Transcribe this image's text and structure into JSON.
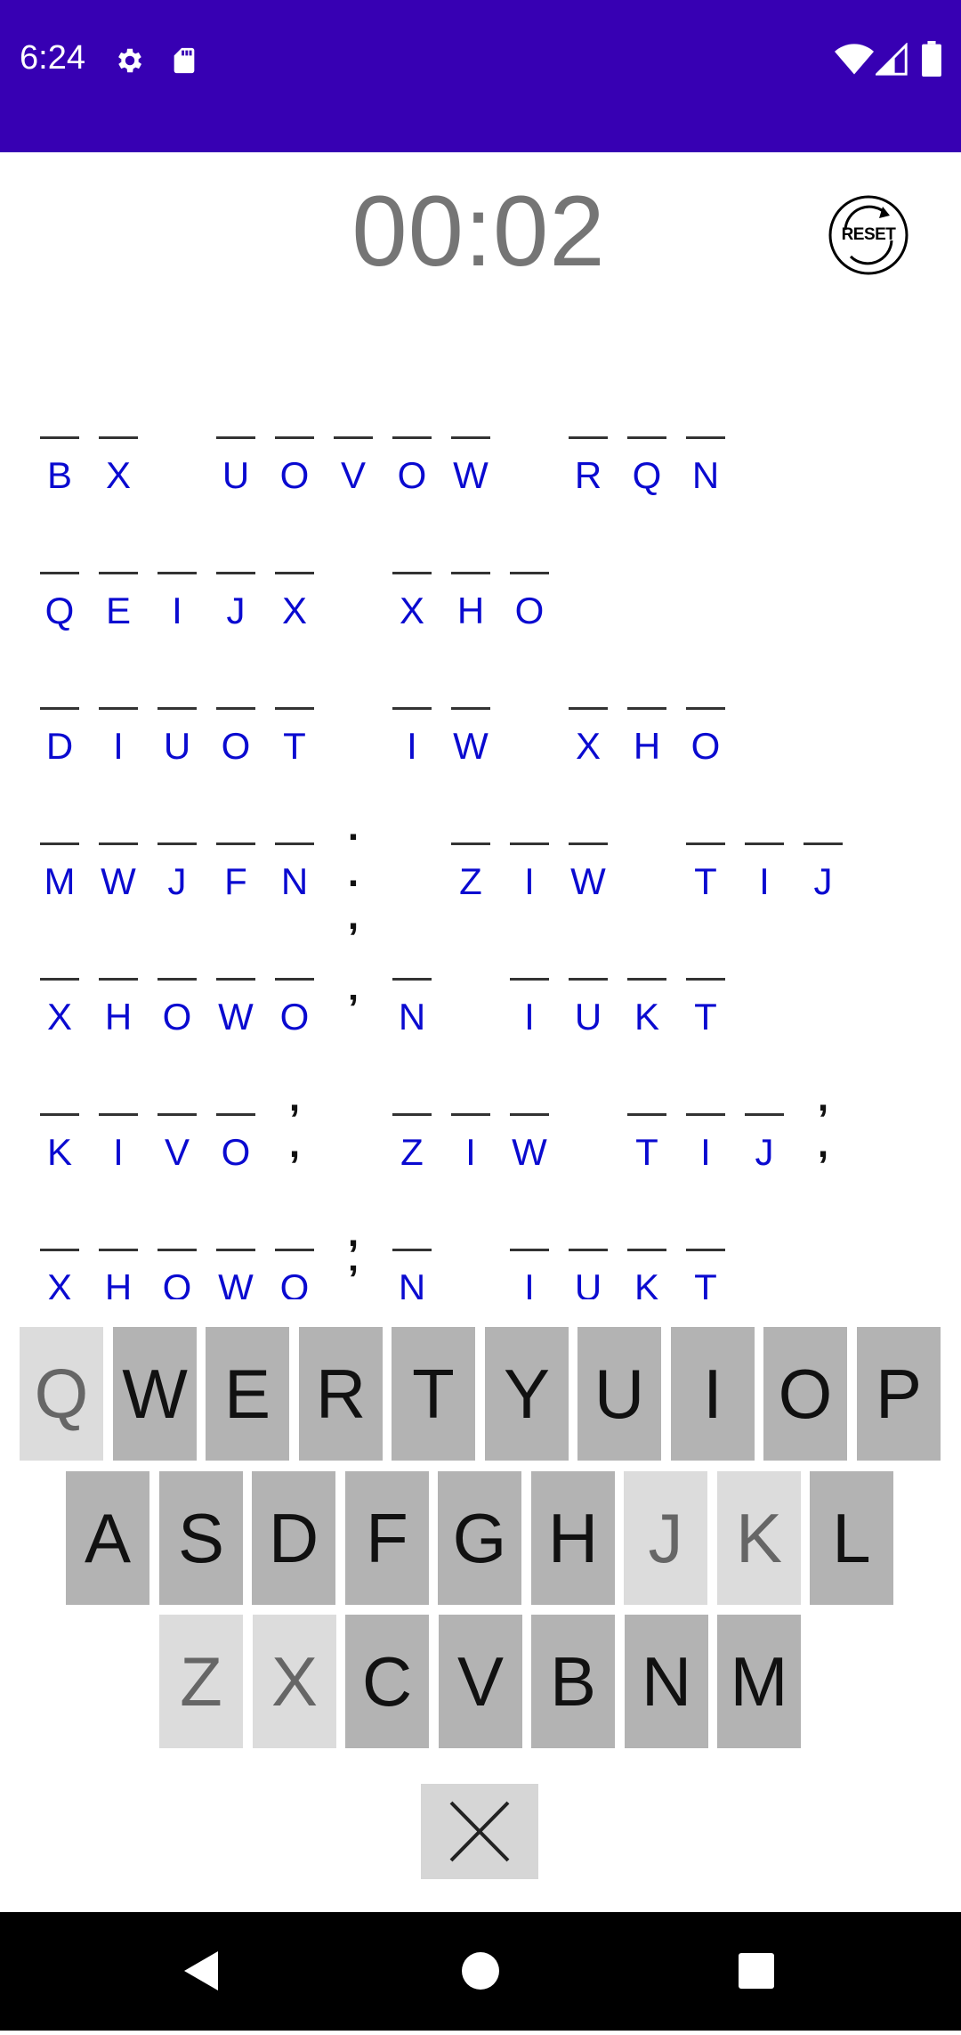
{
  "status_bar": {
    "time": "6:24",
    "left_icons": [
      "gear-icon",
      "sd-card-icon"
    ],
    "right_icons": [
      "wifi-icon",
      "signal-icon",
      "battery-icon"
    ],
    "background": "#3700b3"
  },
  "game": {
    "timer": "00:02",
    "reset_label": "RESET",
    "cipher_color": "#0a0ad0",
    "rows": [
      {
        "slots": [
          "B",
          "X",
          "",
          "U",
          "O",
          "V",
          "O",
          "W",
          "",
          "R",
          "Q",
          "N"
        ],
        "punct": []
      },
      {
        "slots": [
          "Q",
          "E",
          "I",
          "J",
          "X",
          "",
          "X",
          "H",
          "O"
        ],
        "punct": []
      },
      {
        "slots": [
          "D",
          "I",
          "U",
          "O",
          "T",
          "",
          "I",
          "W",
          "",
          "X",
          "H",
          "O"
        ],
        "punct": []
      },
      {
        "slots": [
          "M",
          "W",
          "J",
          "F",
          "N",
          "",
          "",
          "Z",
          "I",
          "W",
          "",
          "T",
          "I",
          "J"
        ],
        "punct": [
          {
            "slot": 5,
            "text": ".",
            "pos": "inline"
          },
          {
            "slot": 5,
            "text": ".",
            "pos": "top"
          },
          {
            "slot": 5,
            "text": ",",
            "pos": "bottom"
          }
        ]
      },
      {
        "slots": [
          "X",
          "H",
          "O",
          "W",
          "O",
          "",
          "N",
          "",
          "I",
          "U",
          "K",
          "T"
        ],
        "punct": [
          {
            "slot": 5,
            "text": "’",
            "pos": "inline"
          }
        ]
      },
      {
        "slots": [
          "K",
          "I",
          "V",
          "O",
          "",
          "",
          "Z",
          "I",
          "W",
          "",
          "T",
          "I",
          "J",
          ""
        ],
        "punct": [
          {
            "slot": 4,
            "text": ",",
            "pos": "inline"
          },
          {
            "slot": 4,
            "text": ",",
            "pos": "top"
          },
          {
            "slot": 13,
            "text": ",",
            "pos": "inline"
          },
          {
            "slot": 13,
            "text": ",",
            "pos": "top"
          }
        ]
      },
      {
        "slots": [
          "X",
          "H",
          "O",
          "W",
          "O",
          "",
          "N",
          "",
          "I",
          "U",
          "K",
          "T"
        ],
        "punct": [
          {
            "slot": 5,
            "text": "’",
            "pos": "inline"
          },
          {
            "slot": 5,
            "text": ",",
            "pos": "top"
          }
        ]
      }
    ]
  },
  "keyboard": {
    "rows": [
      [
        {
          "label": "Q",
          "used": true
        },
        {
          "label": "W",
          "used": false
        },
        {
          "label": "E",
          "used": false
        },
        {
          "label": "R",
          "used": false
        },
        {
          "label": "T",
          "used": false
        },
        {
          "label": "Y",
          "used": false
        },
        {
          "label": "U",
          "used": false
        },
        {
          "label": "I",
          "used": false
        },
        {
          "label": "O",
          "used": false
        },
        {
          "label": "P",
          "used": false
        }
      ],
      [
        {
          "label": "A",
          "used": false
        },
        {
          "label": "S",
          "used": false
        },
        {
          "label": "D",
          "used": false
        },
        {
          "label": "F",
          "used": false
        },
        {
          "label": "G",
          "used": false
        },
        {
          "label": "H",
          "used": false
        },
        {
          "label": "J",
          "used": true
        },
        {
          "label": "K",
          "used": true
        },
        {
          "label": "L",
          "used": false
        }
      ],
      [
        {
          "label": "Z",
          "used": true
        },
        {
          "label": "X",
          "used": true
        },
        {
          "label": "C",
          "used": false
        },
        {
          "label": "V",
          "used": false
        },
        {
          "label": "B",
          "used": false
        },
        {
          "label": "N",
          "used": false
        },
        {
          "label": "M",
          "used": false
        }
      ]
    ],
    "delete_icon": "close-icon",
    "key_color": "#b3b3b3",
    "used_key_color": "#dcdcdc"
  },
  "nav_bar": {
    "buttons": [
      "back-icon",
      "home-icon",
      "recents-icon"
    ]
  }
}
